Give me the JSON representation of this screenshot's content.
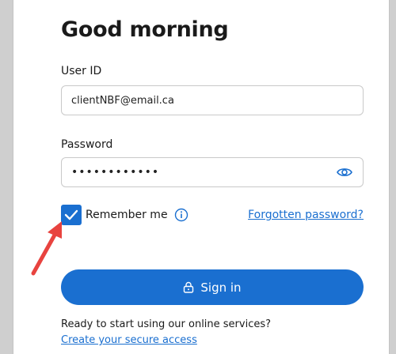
{
  "heading": "Good morning",
  "user_id": {
    "label": "User ID",
    "value": "clientNBF@email.ca"
  },
  "password": {
    "label": "Password",
    "value": "••••••••••••",
    "toggle_icon": "eye-icon"
  },
  "remember": {
    "label": "Remember me",
    "checked": true,
    "info_icon": "info-icon"
  },
  "forgot_link": "Forgotten password?",
  "signin": {
    "label": "Sign in",
    "icon": "lock-icon"
  },
  "footer": {
    "prompt": "Ready to start using our online services?",
    "link": "Create your secure access"
  },
  "colors": {
    "accent": "#1a6fd0",
    "arrow": "#e8433f"
  }
}
